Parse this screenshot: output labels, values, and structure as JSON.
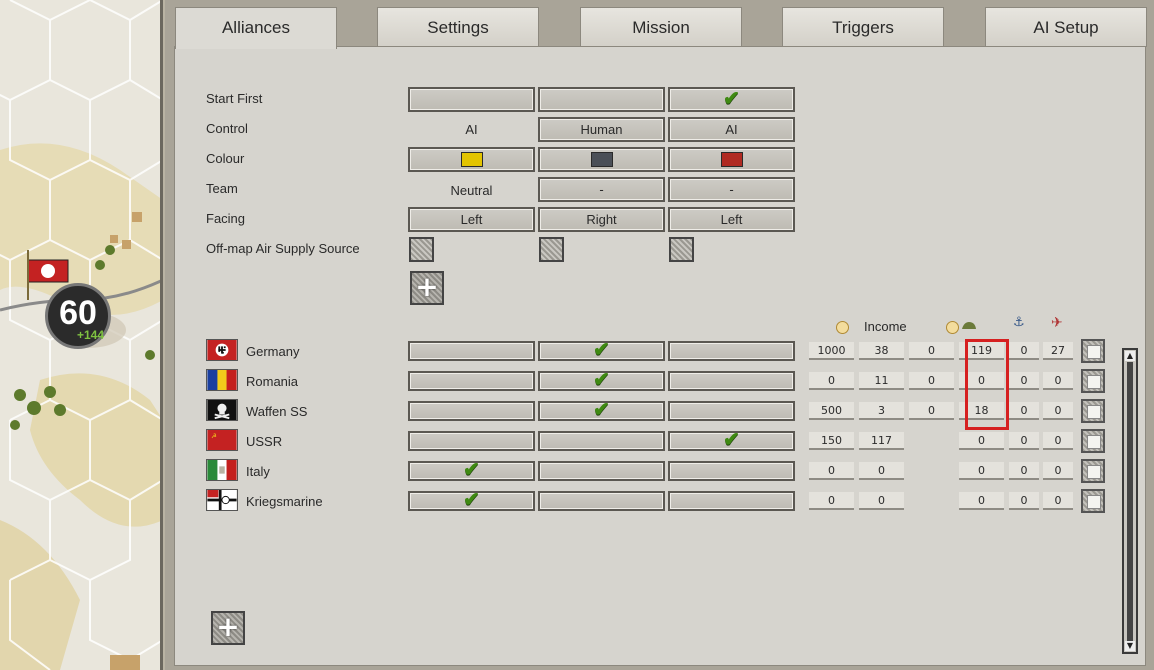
{
  "map": {
    "unit_strength": "60",
    "unit_delta": "+144"
  },
  "tabs": [
    {
      "label": "Alliances",
      "active": true
    },
    {
      "label": "Settings",
      "active": false
    },
    {
      "label": "Mission",
      "active": false
    },
    {
      "label": "Triggers",
      "active": false
    },
    {
      "label": "AI Setup",
      "active": false
    }
  ],
  "settings": {
    "labels": {
      "start_first": "Start First",
      "control": "Control",
      "colour": "Colour",
      "team": "Team",
      "facing": "Facing",
      "air_supply": "Off-map Air Supply Source"
    },
    "columns": [
      {
        "start_first": false,
        "control": "AI",
        "control_is_button": false,
        "colour": "#e3c400",
        "team": "Neutral",
        "team_is_button": false,
        "facing": "Left"
      },
      {
        "start_first": false,
        "control": "Human",
        "control_is_button": true,
        "colour": "#4a4f57",
        "team": "-",
        "team_is_button": true,
        "facing": "Right"
      },
      {
        "start_first": true,
        "control": "AI",
        "control_is_button": true,
        "colour": "#b02a22",
        "team": "-",
        "team_is_button": true,
        "facing": "Left"
      }
    ]
  },
  "header": {
    "income_label": "Income",
    "icons": [
      "income-coin-icon",
      "prestige-coin-icon",
      "land-unit-icon",
      "naval-anchor-icon",
      "air-plane-icon"
    ]
  },
  "factions": [
    {
      "name": "Germany",
      "flag": "germany",
      "alliance": 1,
      "income": "1000",
      "c2": "38",
      "c3": "0",
      "land": "119",
      "naval": "0",
      "air": "27"
    },
    {
      "name": "Romania",
      "flag": "romania",
      "alliance": 1,
      "income": "0",
      "c2": "11",
      "c3": "0",
      "land": "0",
      "naval": "0",
      "air": "0"
    },
    {
      "name": "Waffen SS",
      "flag": "waffen-ss",
      "alliance": 1,
      "income": "500",
      "c2": "3",
      "c3": "0",
      "land": "18",
      "naval": "0",
      "air": "0"
    },
    {
      "name": "USSR",
      "flag": "ussr",
      "alliance": 2,
      "income": "150",
      "c2": "117",
      "c3": null,
      "land": "0",
      "naval": "0",
      "air": "0"
    },
    {
      "name": "Italy",
      "flag": "italy",
      "alliance": 0,
      "income": "0",
      "c2": "0",
      "c3": null,
      "land": "0",
      "naval": "0",
      "air": "0"
    },
    {
      "name": "Kriegsmarine",
      "flag": "kriegsmarine",
      "alliance": 0,
      "income": "0",
      "c2": "0",
      "c3": null,
      "land": "0",
      "naval": "0",
      "air": "0"
    }
  ],
  "colors": {
    "check": "#3f8a12",
    "highlight": "#d62020"
  }
}
